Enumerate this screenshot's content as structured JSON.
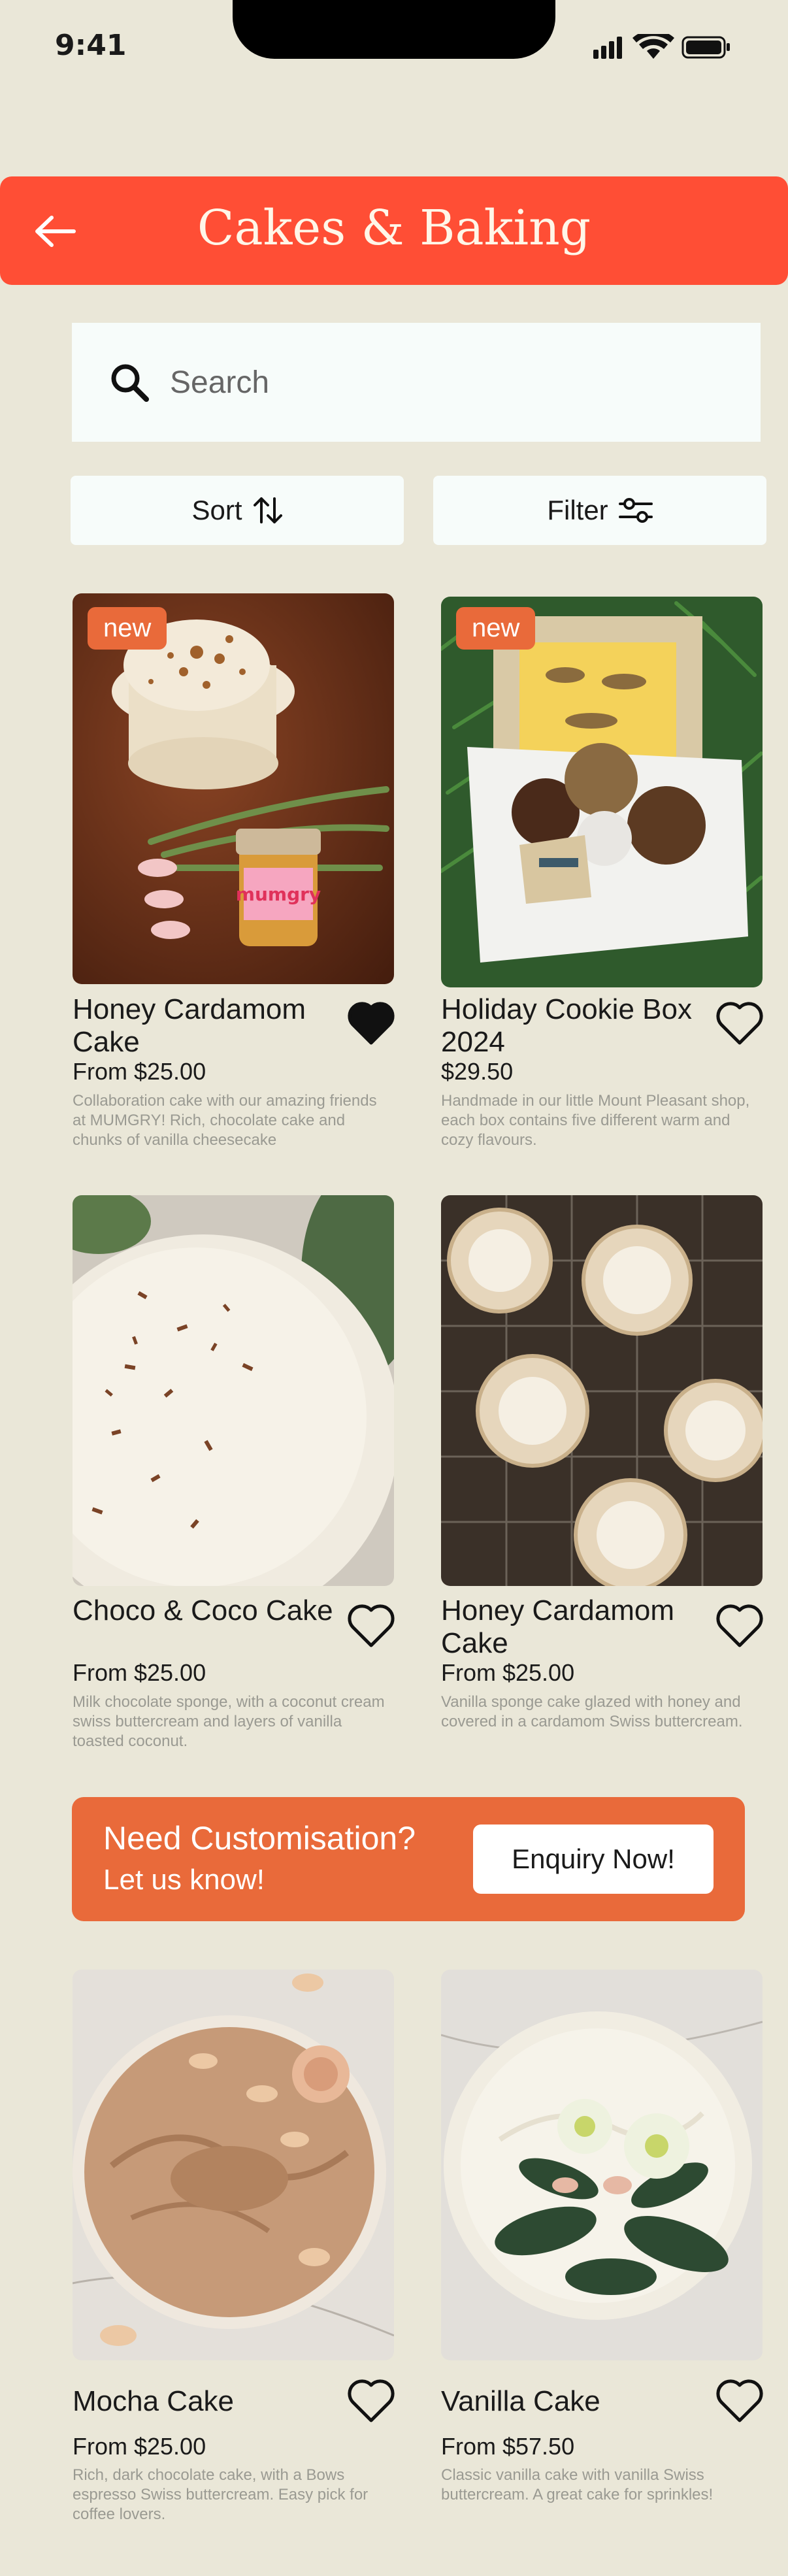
{
  "status_bar": {
    "time": "9:41"
  },
  "header": {
    "title": "Cakes & Baking"
  },
  "search": {
    "placeholder": "Search"
  },
  "controls": {
    "sort_label": "Sort",
    "filter_label": "Filter"
  },
  "products": [
    {
      "name": "Honey Cardamom Cake",
      "price": "From $25.00",
      "description": "Collaboration cake with our amazing friends at MUMGRY! Rich, chocolate cake and chunks of vanilla cheesecake",
      "badge": "new",
      "favorited": true,
      "jar_label": "mumgry"
    },
    {
      "name": "Holiday Cookie Box 2024",
      "price": "$29.50",
      "description": "Handmade in our little Mount Pleasant shop, each box contains five different warm and cozy flavours.",
      "badge": "new",
      "favorited": false
    },
    {
      "name": "Choco & Coco Cake",
      "price": "From $25.00",
      "description": "Milk chocolate sponge, with a coconut cream swiss buttercream and layers of vanilla toasted coconut.",
      "favorited": false
    },
    {
      "name": "Honey Cardamom Cake",
      "price": "From $25.00",
      "description": "Vanilla sponge cake glazed with honey and covered in a cardamom Swiss buttercream.",
      "favorited": false
    },
    {
      "name": "Mocha Cake",
      "price": "From $25.00",
      "description": "Rich, dark chocolate cake, with a Bows espresso Swiss buttercream. Easy pick for coffee lovers.",
      "favorited": false
    },
    {
      "name": "Vanilla Cake",
      "price": "From $57.50",
      "description": "Classic vanilla cake with vanilla Swiss buttercream. A great cake for sprinkles!",
      "favorited": false
    }
  ],
  "banner": {
    "headline": "Need Customisation?",
    "subline": "Let us know!",
    "cta_label": "Enquiry Now!"
  },
  "colors": {
    "background": "#EAE7D8",
    "header": "#FF4E35",
    "accent": "#E96A3A",
    "field": "#F7FCFA"
  },
  "icons": [
    "back-arrow-icon",
    "search-icon",
    "sort-arrows-icon",
    "filter-sliders-icon",
    "heart-icon",
    "signal-icon",
    "wifi-icon",
    "battery-icon"
  ]
}
